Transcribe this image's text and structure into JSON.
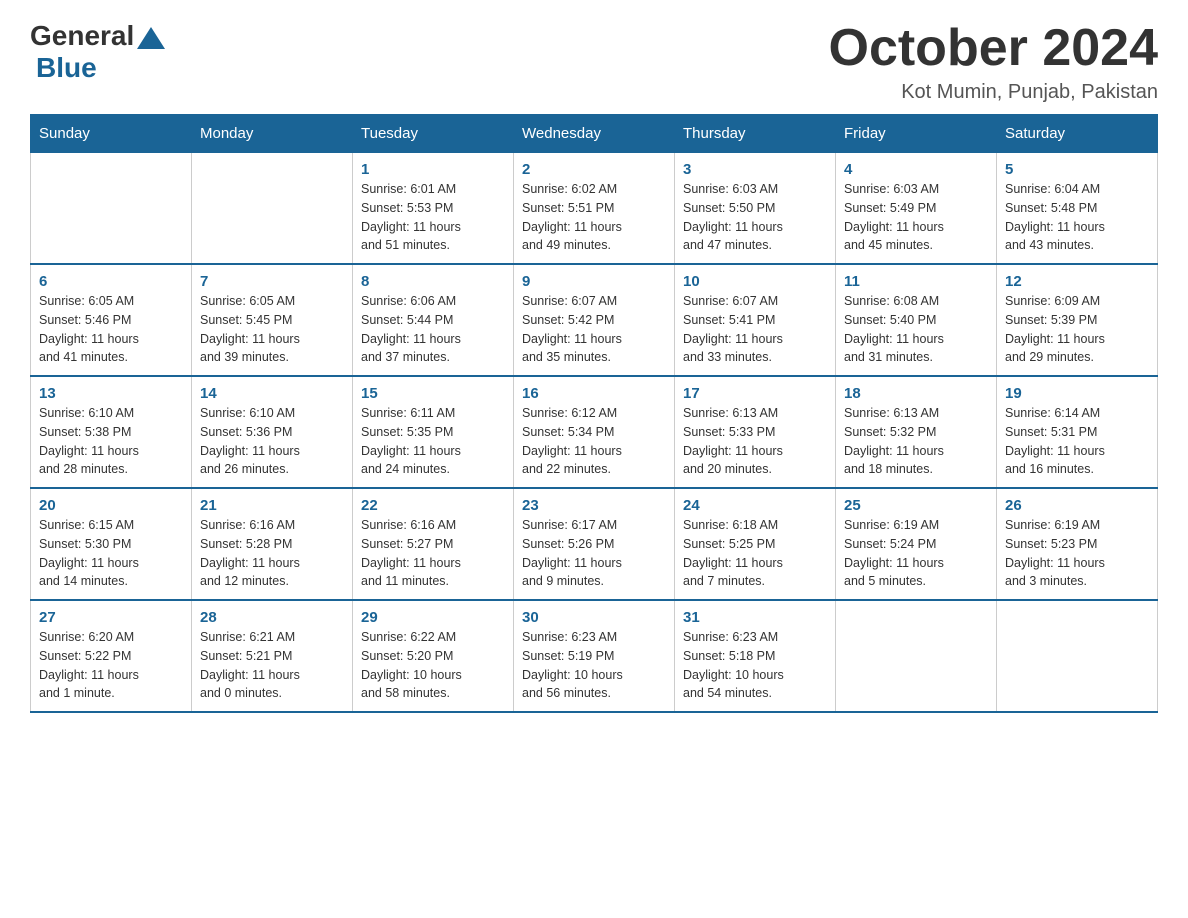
{
  "logo": {
    "general": "General",
    "blue": "Blue"
  },
  "title": "October 2024",
  "location": "Kot Mumin, Punjab, Pakistan",
  "weekdays": [
    "Sunday",
    "Monday",
    "Tuesday",
    "Wednesday",
    "Thursday",
    "Friday",
    "Saturday"
  ],
  "weeks": [
    [
      {
        "day": "",
        "info": ""
      },
      {
        "day": "",
        "info": ""
      },
      {
        "day": "1",
        "info": "Sunrise: 6:01 AM\nSunset: 5:53 PM\nDaylight: 11 hours\nand 51 minutes."
      },
      {
        "day": "2",
        "info": "Sunrise: 6:02 AM\nSunset: 5:51 PM\nDaylight: 11 hours\nand 49 minutes."
      },
      {
        "day": "3",
        "info": "Sunrise: 6:03 AM\nSunset: 5:50 PM\nDaylight: 11 hours\nand 47 minutes."
      },
      {
        "day": "4",
        "info": "Sunrise: 6:03 AM\nSunset: 5:49 PM\nDaylight: 11 hours\nand 45 minutes."
      },
      {
        "day": "5",
        "info": "Sunrise: 6:04 AM\nSunset: 5:48 PM\nDaylight: 11 hours\nand 43 minutes."
      }
    ],
    [
      {
        "day": "6",
        "info": "Sunrise: 6:05 AM\nSunset: 5:46 PM\nDaylight: 11 hours\nand 41 minutes."
      },
      {
        "day": "7",
        "info": "Sunrise: 6:05 AM\nSunset: 5:45 PM\nDaylight: 11 hours\nand 39 minutes."
      },
      {
        "day": "8",
        "info": "Sunrise: 6:06 AM\nSunset: 5:44 PM\nDaylight: 11 hours\nand 37 minutes."
      },
      {
        "day": "9",
        "info": "Sunrise: 6:07 AM\nSunset: 5:42 PM\nDaylight: 11 hours\nand 35 minutes."
      },
      {
        "day": "10",
        "info": "Sunrise: 6:07 AM\nSunset: 5:41 PM\nDaylight: 11 hours\nand 33 minutes."
      },
      {
        "day": "11",
        "info": "Sunrise: 6:08 AM\nSunset: 5:40 PM\nDaylight: 11 hours\nand 31 minutes."
      },
      {
        "day": "12",
        "info": "Sunrise: 6:09 AM\nSunset: 5:39 PM\nDaylight: 11 hours\nand 29 minutes."
      }
    ],
    [
      {
        "day": "13",
        "info": "Sunrise: 6:10 AM\nSunset: 5:38 PM\nDaylight: 11 hours\nand 28 minutes."
      },
      {
        "day": "14",
        "info": "Sunrise: 6:10 AM\nSunset: 5:36 PM\nDaylight: 11 hours\nand 26 minutes."
      },
      {
        "day": "15",
        "info": "Sunrise: 6:11 AM\nSunset: 5:35 PM\nDaylight: 11 hours\nand 24 minutes."
      },
      {
        "day": "16",
        "info": "Sunrise: 6:12 AM\nSunset: 5:34 PM\nDaylight: 11 hours\nand 22 minutes."
      },
      {
        "day": "17",
        "info": "Sunrise: 6:13 AM\nSunset: 5:33 PM\nDaylight: 11 hours\nand 20 minutes."
      },
      {
        "day": "18",
        "info": "Sunrise: 6:13 AM\nSunset: 5:32 PM\nDaylight: 11 hours\nand 18 minutes."
      },
      {
        "day": "19",
        "info": "Sunrise: 6:14 AM\nSunset: 5:31 PM\nDaylight: 11 hours\nand 16 minutes."
      }
    ],
    [
      {
        "day": "20",
        "info": "Sunrise: 6:15 AM\nSunset: 5:30 PM\nDaylight: 11 hours\nand 14 minutes."
      },
      {
        "day": "21",
        "info": "Sunrise: 6:16 AM\nSunset: 5:28 PM\nDaylight: 11 hours\nand 12 minutes."
      },
      {
        "day": "22",
        "info": "Sunrise: 6:16 AM\nSunset: 5:27 PM\nDaylight: 11 hours\nand 11 minutes."
      },
      {
        "day": "23",
        "info": "Sunrise: 6:17 AM\nSunset: 5:26 PM\nDaylight: 11 hours\nand 9 minutes."
      },
      {
        "day": "24",
        "info": "Sunrise: 6:18 AM\nSunset: 5:25 PM\nDaylight: 11 hours\nand 7 minutes."
      },
      {
        "day": "25",
        "info": "Sunrise: 6:19 AM\nSunset: 5:24 PM\nDaylight: 11 hours\nand 5 minutes."
      },
      {
        "day": "26",
        "info": "Sunrise: 6:19 AM\nSunset: 5:23 PM\nDaylight: 11 hours\nand 3 minutes."
      }
    ],
    [
      {
        "day": "27",
        "info": "Sunrise: 6:20 AM\nSunset: 5:22 PM\nDaylight: 11 hours\nand 1 minute."
      },
      {
        "day": "28",
        "info": "Sunrise: 6:21 AM\nSunset: 5:21 PM\nDaylight: 11 hours\nand 0 minutes."
      },
      {
        "day": "29",
        "info": "Sunrise: 6:22 AM\nSunset: 5:20 PM\nDaylight: 10 hours\nand 58 minutes."
      },
      {
        "day": "30",
        "info": "Sunrise: 6:23 AM\nSunset: 5:19 PM\nDaylight: 10 hours\nand 56 minutes."
      },
      {
        "day": "31",
        "info": "Sunrise: 6:23 AM\nSunset: 5:18 PM\nDaylight: 10 hours\nand 54 minutes."
      },
      {
        "day": "",
        "info": ""
      },
      {
        "day": "",
        "info": ""
      }
    ]
  ]
}
